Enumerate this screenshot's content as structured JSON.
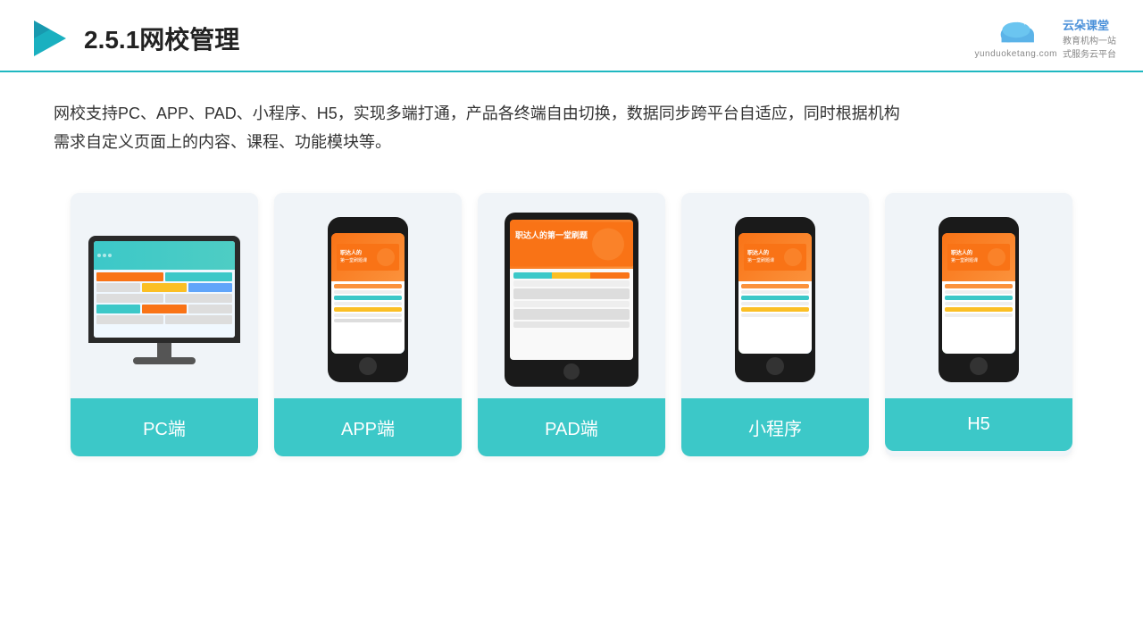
{
  "header": {
    "title": "2.5.1网校管理",
    "brand_name": "云朵课堂",
    "brand_tagline_line1": "教育机构一站",
    "brand_tagline_line2": "式服务云平台",
    "brand_url": "yunduoketang.com"
  },
  "description": {
    "text_line1": "网校支持PC、APP、PAD、小程序、H5，实现多端打通，产品各终端自由切换，数据同步跨平台自适应，同时根据机构",
    "text_line2": "需求自定义页面上的内容、课程、功能模块等。"
  },
  "cards": [
    {
      "id": "pc",
      "label": "PC端"
    },
    {
      "id": "app",
      "label": "APP端"
    },
    {
      "id": "pad",
      "label": "PAD端"
    },
    {
      "id": "miniapp",
      "label": "小程序"
    },
    {
      "id": "h5",
      "label": "H5"
    }
  ]
}
